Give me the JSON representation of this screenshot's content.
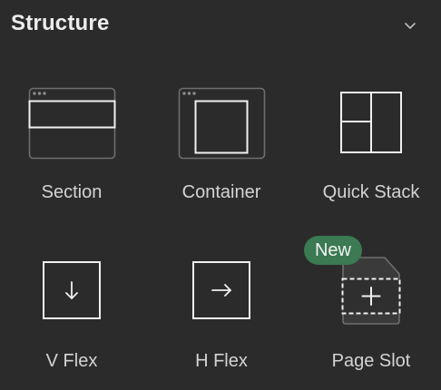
{
  "panel": {
    "title": "Structure",
    "collapse_icon": "chevron-down-icon"
  },
  "items": [
    {
      "label": "Section",
      "icon": "section-icon"
    },
    {
      "label": "Container",
      "icon": "container-icon"
    },
    {
      "label": "Quick Stack",
      "icon": "quick-stack-icon"
    },
    {
      "label": "V Flex",
      "icon": "arrow-down-icon"
    },
    {
      "label": "H Flex",
      "icon": "arrow-right-icon"
    },
    {
      "label": "Page Slot",
      "icon": "page-slot-icon",
      "badge": "New"
    }
  ],
  "colors": {
    "background": "#2b2b2b",
    "icon_stroke": "#f0f0f0",
    "frame_stroke": "#6e6e6e",
    "badge_bg": "#3b7a52"
  }
}
